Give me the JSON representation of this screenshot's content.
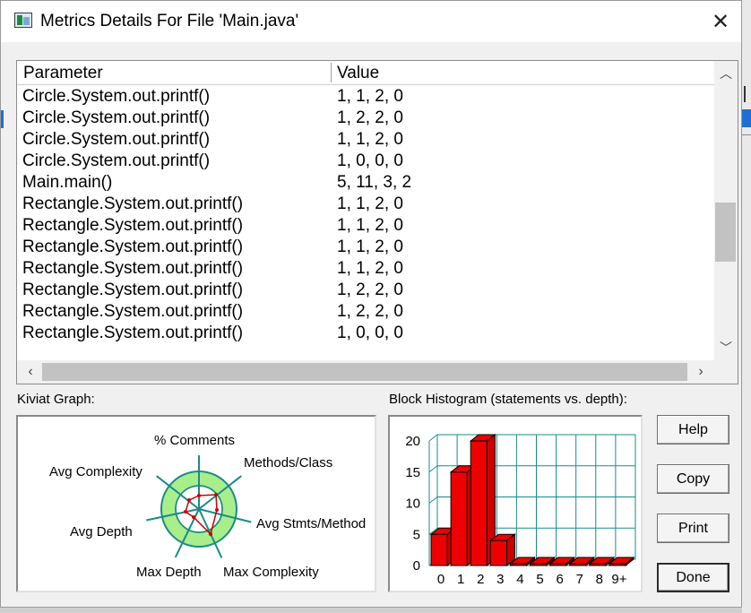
{
  "window": {
    "title": "Metrics Details For File 'Main.java'"
  },
  "table": {
    "headers": {
      "parameter": "Parameter",
      "value": "Value"
    },
    "rows": [
      {
        "parameter": "Circle.System.out.printf()",
        "value": "1, 1, 2, 0"
      },
      {
        "parameter": "Circle.System.out.printf()",
        "value": "1, 2, 2, 0"
      },
      {
        "parameter": "Circle.System.out.printf()",
        "value": "1, 1, 2, 0"
      },
      {
        "parameter": "Circle.System.out.printf()",
        "value": "1, 0, 0, 0"
      },
      {
        "parameter": "Main.main()",
        "value": "5, 11, 3, 2"
      },
      {
        "parameter": "Rectangle.System.out.printf()",
        "value": "1, 1, 2, 0"
      },
      {
        "parameter": "Rectangle.System.out.printf()",
        "value": "1, 1, 2, 0"
      },
      {
        "parameter": "Rectangle.System.out.printf()",
        "value": "1, 1, 2, 0"
      },
      {
        "parameter": "Rectangle.System.out.printf()",
        "value": "1, 1, 2, 0"
      },
      {
        "parameter": "Rectangle.System.out.printf()",
        "value": "1, 2, 2, 0"
      },
      {
        "parameter": "Rectangle.System.out.printf()",
        "value": "1, 2, 2, 0"
      },
      {
        "parameter": "Rectangle.System.out.printf()",
        "value": "1, 0, 0, 0"
      }
    ]
  },
  "kiviat": {
    "label": "Kiviat Graph:",
    "axes": [
      "% Comments",
      "Methods/Class",
      "Avg Stmts/Method",
      "Max Complexity",
      "Max Depth",
      "Avg Depth",
      "Avg Complexity"
    ],
    "colors": {
      "ring": "#a8ee8a",
      "line": "#cc0000",
      "axis": "#1b8a8a"
    }
  },
  "histogram": {
    "label": "Block Histogram (statements vs. depth):",
    "categories": [
      "0",
      "1",
      "2",
      "3",
      "4",
      "5",
      "6",
      "7",
      "8",
      "9+"
    ],
    "yticks": [
      "0",
      "5",
      "10",
      "15",
      "20"
    ],
    "colors": {
      "bar": "#ee0000",
      "grid": "#1b8a8a"
    }
  },
  "chart_data": {
    "type": "bar",
    "categories": [
      "0",
      "1",
      "2",
      "3",
      "4",
      "5",
      "6",
      "7",
      "8",
      "9+"
    ],
    "values": [
      5,
      15,
      20,
      4,
      0,
      0,
      0,
      0,
      0,
      0
    ],
    "title": "Block Histogram (statements vs. depth):",
    "ylim": [
      0,
      20
    ],
    "grid": true
  },
  "buttons": {
    "help": "Help",
    "copy": "Copy",
    "print": "Print",
    "done": "Done"
  }
}
